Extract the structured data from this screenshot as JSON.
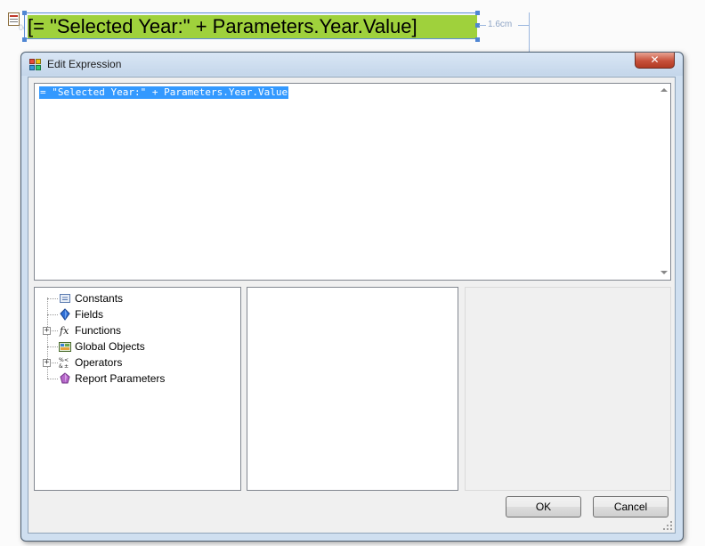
{
  "designer": {
    "textbox_expression": "[= \"Selected Year:\" + Parameters.Year.Value]",
    "width_label": "1.6cm",
    "ruler_marker": "0cm",
    "colors": {
      "textbox_fill": "#9fd13c",
      "selection": "#4f86d3"
    }
  },
  "dialog": {
    "title": "Edit Expression",
    "close_label": "✕",
    "expression": "= \"Selected Year:\" + Parameters.Year.Value",
    "tree": [
      {
        "label": "Constants",
        "icon": "constants-icon",
        "expandable": false
      },
      {
        "label": "Fields",
        "icon": "fields-icon",
        "expandable": false
      },
      {
        "label": "Functions",
        "icon": "functions-icon",
        "expandable": true
      },
      {
        "label": "Global Objects",
        "icon": "global-objects-icon",
        "expandable": false
      },
      {
        "label": "Operators",
        "icon": "operators-icon",
        "expandable": true
      },
      {
        "label": "Report Parameters",
        "icon": "report-parameters-icon",
        "expandable": false
      }
    ],
    "buttons": {
      "ok": "OK",
      "cancel": "Cancel"
    }
  }
}
